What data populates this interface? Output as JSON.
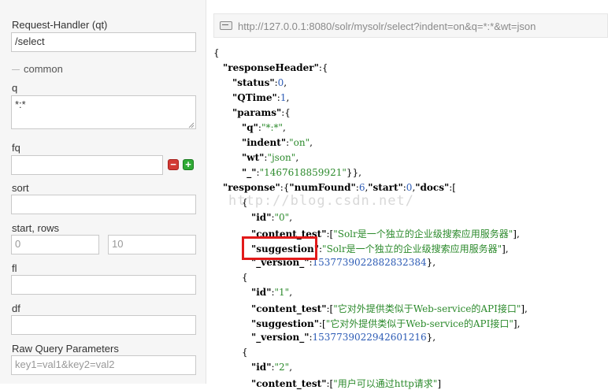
{
  "form": {
    "request_handler": {
      "label": "Request-Handler (qt)",
      "value": "/select"
    },
    "common_section": "common",
    "q": {
      "label": "q",
      "value": "*:*"
    },
    "fq": {
      "label": "fq",
      "value": "",
      "remove_symbol": "−",
      "add_symbol": "+"
    },
    "sort": {
      "label": "sort",
      "value": ""
    },
    "start_rows": {
      "label": "start, rows",
      "start_placeholder": "0",
      "rows_placeholder": "10"
    },
    "fl": {
      "label": "fl",
      "value": ""
    },
    "df": {
      "label": "df",
      "value": ""
    },
    "raw_query": {
      "label": "Raw Query Parameters",
      "placeholder": "key1=val1&key2=val2"
    }
  },
  "url_bar": {
    "icon": "link-icon",
    "url": "http://127.0.0.1:8080/solr/mysolr/select?indent=on&q=*:*&wt=json"
  },
  "json_lines": [
    {
      "indent": 0,
      "tokens": [
        {
          "t": "p",
          "v": "{"
        }
      ]
    },
    {
      "indent": 1,
      "tokens": [
        {
          "t": "k",
          "v": "\"responseHeader\""
        },
        {
          "t": "p",
          "v": ":{"
        }
      ]
    },
    {
      "indent": 2,
      "tokens": [
        {
          "t": "k",
          "v": "\"status\""
        },
        {
          "t": "p",
          "v": ":"
        },
        {
          "t": "n",
          "v": "0"
        },
        {
          "t": "p",
          "v": ","
        }
      ]
    },
    {
      "indent": 2,
      "tokens": [
        {
          "t": "k",
          "v": "\"QTime\""
        },
        {
          "t": "p",
          "v": ":"
        },
        {
          "t": "n",
          "v": "1"
        },
        {
          "t": "p",
          "v": ","
        }
      ]
    },
    {
      "indent": 2,
      "tokens": [
        {
          "t": "k",
          "v": "\"params\""
        },
        {
          "t": "p",
          "v": ":{"
        }
      ]
    },
    {
      "indent": 3,
      "tokens": [
        {
          "t": "k",
          "v": "\"q\""
        },
        {
          "t": "p",
          "v": ":"
        },
        {
          "t": "s",
          "v": "\"*:*\""
        },
        {
          "t": "p",
          "v": ","
        }
      ]
    },
    {
      "indent": 3,
      "tokens": [
        {
          "t": "k",
          "v": "\"indent\""
        },
        {
          "t": "p",
          "v": ":"
        },
        {
          "t": "s",
          "v": "\"on\""
        },
        {
          "t": "p",
          "v": ","
        }
      ]
    },
    {
      "indent": 3,
      "tokens": [
        {
          "t": "k",
          "v": "\"wt\""
        },
        {
          "t": "p",
          "v": ":"
        },
        {
          "t": "s",
          "v": "\"json\""
        },
        {
          "t": "p",
          "v": ","
        }
      ]
    },
    {
      "indent": 3,
      "tokens": [
        {
          "t": "k",
          "v": "\"_\""
        },
        {
          "t": "p",
          "v": ":"
        },
        {
          "t": "s",
          "v": "\"1467618859921\""
        },
        {
          "t": "p",
          "v": "}},"
        }
      ]
    },
    {
      "indent": 1,
      "tokens": [
        {
          "t": "k",
          "v": "\"response\""
        },
        {
          "t": "p",
          "v": ":{"
        },
        {
          "t": "k",
          "v": "\"numFound\""
        },
        {
          "t": "p",
          "v": ":"
        },
        {
          "t": "n",
          "v": "6"
        },
        {
          "t": "p",
          "v": ","
        },
        {
          "t": "k",
          "v": "\"start\""
        },
        {
          "t": "p",
          "v": ":"
        },
        {
          "t": "n",
          "v": "0"
        },
        {
          "t": "p",
          "v": ","
        },
        {
          "t": "k",
          "v": "\"docs\""
        },
        {
          "t": "p",
          "v": ":["
        }
      ]
    },
    {
      "indent": 3,
      "tokens": [
        {
          "t": "p",
          "v": "{"
        }
      ]
    },
    {
      "indent": 4,
      "tokens": [
        {
          "t": "k",
          "v": "\"id\""
        },
        {
          "t": "p",
          "v": ":"
        },
        {
          "t": "s",
          "v": "\"0\""
        },
        {
          "t": "p",
          "v": ","
        }
      ]
    },
    {
      "indent": 4,
      "tokens": [
        {
          "t": "k",
          "v": "\"content_test\""
        },
        {
          "t": "p",
          "v": ":["
        },
        {
          "t": "s",
          "v": "\"Solr是一个独立的企业级搜索应用服务器\""
        },
        {
          "t": "p",
          "v": "],"
        }
      ]
    },
    {
      "indent": 4,
      "tokens": [
        {
          "t": "k",
          "v": "\"suggestion\""
        },
        {
          "t": "p",
          "v": ":"
        },
        {
          "t": "s",
          "v": "\"Solr是一个独立的企业级搜索应用服务器\""
        },
        {
          "t": "p",
          "v": "],"
        }
      ]
    },
    {
      "indent": 4,
      "tokens": [
        {
          "t": "k",
          "v": "\"_version_\""
        },
        {
          "t": "p",
          "v": ":"
        },
        {
          "t": "n",
          "v": "1537739022882832384"
        },
        {
          "t": "p",
          "v": "},"
        }
      ]
    },
    {
      "indent": 3,
      "tokens": [
        {
          "t": "p",
          "v": "{"
        }
      ]
    },
    {
      "indent": 4,
      "tokens": [
        {
          "t": "k",
          "v": "\"id\""
        },
        {
          "t": "p",
          "v": ":"
        },
        {
          "t": "s",
          "v": "\"1\""
        },
        {
          "t": "p",
          "v": ","
        }
      ]
    },
    {
      "indent": 4,
      "tokens": [
        {
          "t": "k",
          "v": "\"content_test\""
        },
        {
          "t": "p",
          "v": ":["
        },
        {
          "t": "s",
          "v": "\"它对外提供类似于Web-service的API接口\""
        },
        {
          "t": "p",
          "v": "],"
        }
      ]
    },
    {
      "indent": 4,
      "tokens": [
        {
          "t": "k",
          "v": "\"suggestion\""
        },
        {
          "t": "p",
          "v": ":["
        },
        {
          "t": "s",
          "v": "\"它对外提供类似于Web-service的API接口\""
        },
        {
          "t": "p",
          "v": "],"
        }
      ]
    },
    {
      "indent": 4,
      "tokens": [
        {
          "t": "k",
          "v": "\"_version_\""
        },
        {
          "t": "p",
          "v": ":"
        },
        {
          "t": "n",
          "v": "1537739022942601216"
        },
        {
          "t": "p",
          "v": "},"
        }
      ]
    },
    {
      "indent": 3,
      "tokens": [
        {
          "t": "p",
          "v": "{"
        }
      ]
    },
    {
      "indent": 4,
      "tokens": [
        {
          "t": "k",
          "v": "\"id\""
        },
        {
          "t": "p",
          "v": ":"
        },
        {
          "t": "s",
          "v": "\"2\""
        },
        {
          "t": "p",
          "v": ","
        }
      ]
    },
    {
      "indent": 4,
      "tokens": [
        {
          "t": "k",
          "v": "\"content_test\""
        },
        {
          "t": "p",
          "v": ":["
        },
        {
          "t": "s",
          "v": "\"用户可以通过http请求\""
        },
        {
          "t": "p",
          "v": "]"
        }
      ]
    }
  ],
  "watermark": "http://blog.csdn.net/",
  "highlight_label": "suggestion-highlight"
}
